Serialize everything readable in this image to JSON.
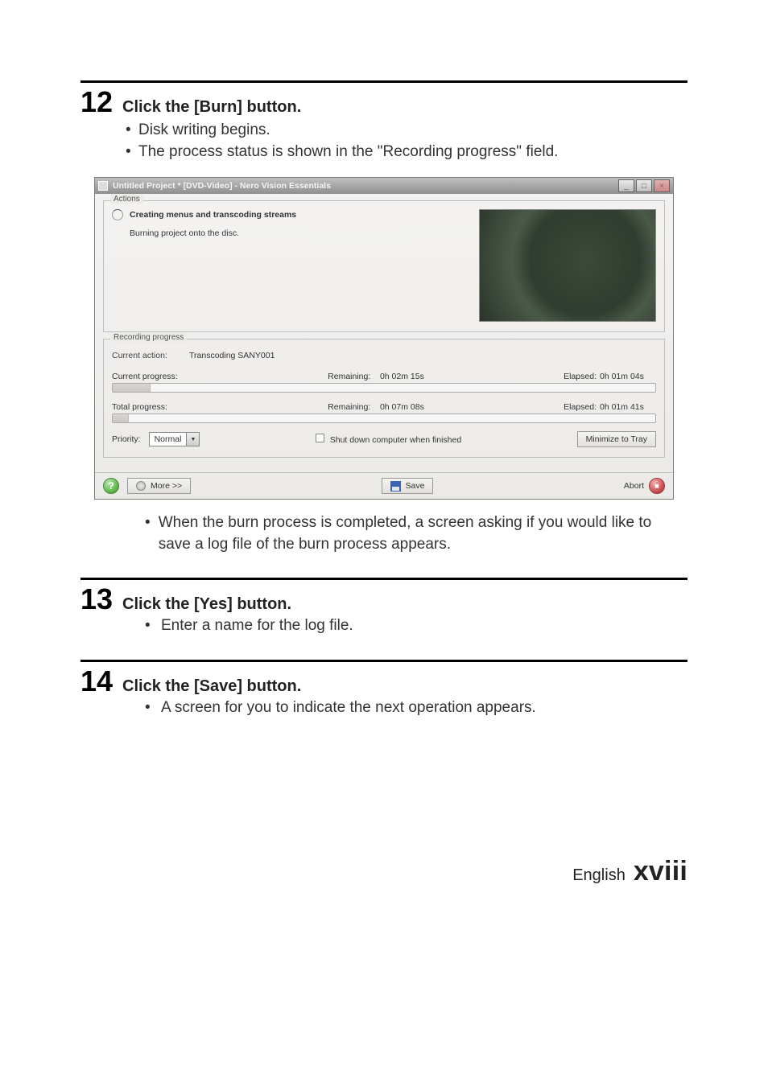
{
  "steps": {
    "s12": {
      "num": "12",
      "title": "Click the [Burn] button.",
      "bullets": [
        "Disk writing begins.",
        "The process status is shown in the \"Recording progress\" field."
      ],
      "sub_bullet": "When the burn process is completed, a screen asking if you would like to save a log file of the burn process appears."
    },
    "s13": {
      "num": "13",
      "title": "Click the [Yes] button.",
      "bullets": [
        "Enter a name for the log file."
      ]
    },
    "s14": {
      "num": "14",
      "title": "Click the [Save] button.",
      "bullets": [
        "A screen for you to indicate the next operation appears."
      ]
    }
  },
  "win": {
    "title": "Untitled Project * [DVD-Video] - Nero Vision Essentials",
    "groups": {
      "actions": {
        "label": "Actions",
        "line1": "Creating menus and transcoding streams",
        "line2": "Burning project onto the disc."
      },
      "recording": {
        "label": "Recording progress",
        "current_action_label": "Current action:",
        "current_action_value": "Transcoding SANY001",
        "current_progress_label": "Current progress:",
        "total_progress_label": "Total progress:",
        "remaining_label": "Remaining:",
        "elapsed_label": "Elapsed:",
        "current_remaining": "0h 02m 15s",
        "current_elapsed": "0h 01m 04s",
        "total_remaining": "0h 07m 08s",
        "total_elapsed": "0h 01m 41s",
        "priority_label": "Priority:",
        "priority_value": "Normal",
        "shutdown_label": "Shut down computer when finished",
        "minimize_label": "Minimize to Tray"
      }
    },
    "footer": {
      "more_label": "More >>",
      "save_label": "Save",
      "abort_label": "Abort"
    }
  },
  "footer": {
    "lang": "English",
    "page": "xviii"
  }
}
